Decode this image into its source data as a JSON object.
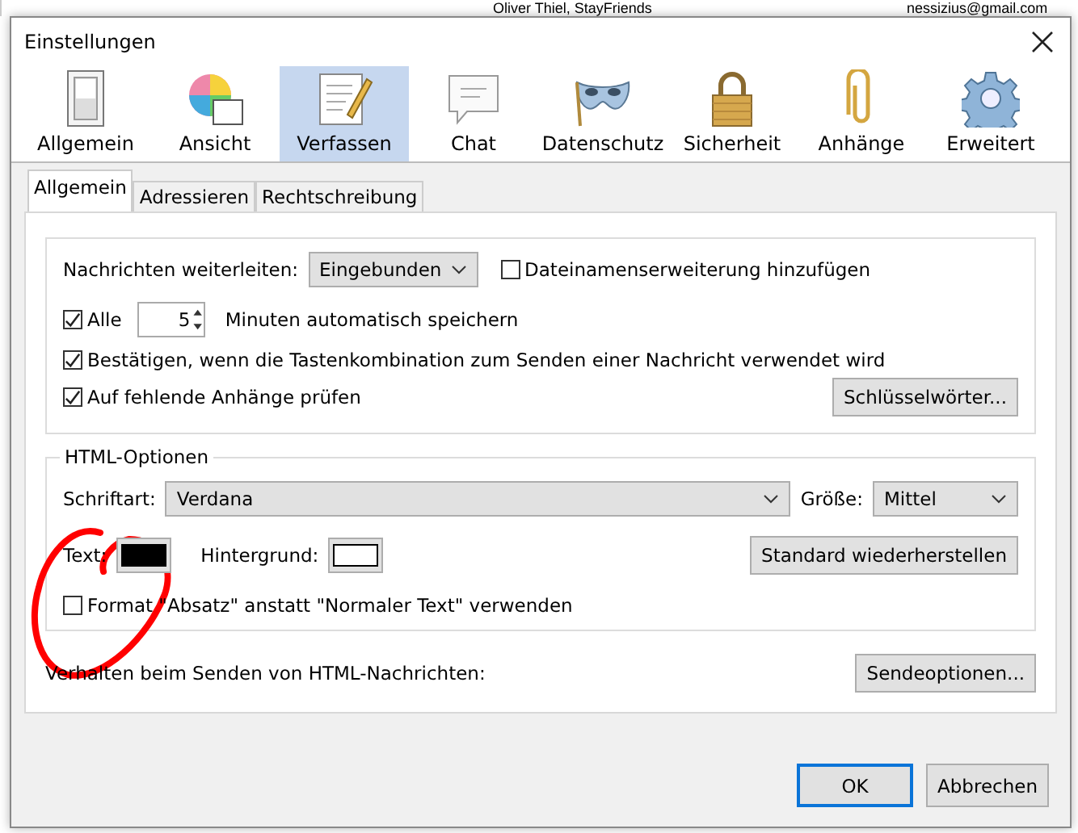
{
  "background": {
    "sender": "Oliver Thiel, StayFriends",
    "email": "nessizius@gmail.com"
  },
  "window": {
    "title": "Einstellungen"
  },
  "categories": [
    {
      "label": "Allgemein",
      "kind": "general",
      "selected": false
    },
    {
      "label": "Ansicht",
      "kind": "display",
      "selected": false
    },
    {
      "label": "Verfassen",
      "kind": "compose",
      "selected": true
    },
    {
      "label": "Chat",
      "kind": "chat",
      "selected": false
    },
    {
      "label": "Datenschutz",
      "kind": "privacy",
      "selected": false
    },
    {
      "label": "Sicherheit",
      "kind": "security",
      "selected": false
    },
    {
      "label": "Anhänge",
      "kind": "attachments",
      "selected": false
    },
    {
      "label": "Erweitert",
      "kind": "advanced",
      "selected": false
    }
  ],
  "tabs": [
    {
      "label": "Allgemein",
      "selected": true
    },
    {
      "label": "Adressieren",
      "selected": false
    },
    {
      "label": "Rechtschreibung",
      "selected": false
    }
  ],
  "forwarding": {
    "label": "Nachrichten weiterleiten:",
    "value": "Eingebunden",
    "extension": {
      "label": "Dateinamenserweiterung hinzufügen",
      "checked": false
    }
  },
  "autosave": {
    "label": "Alle",
    "checked": true,
    "value": "5",
    "suffix": "Minuten automatisch speichern"
  },
  "confirm": {
    "label": "Bestätigen, wenn die Tastenkombination zum Senden einer Nachricht verwendet wird",
    "checked": true
  },
  "attachments": {
    "label": "Auf fehlende Anhänge prüfen",
    "checked": true,
    "button": "Schlüsselwörter..."
  },
  "html_options": {
    "title": "HTML-Optionen",
    "font_label": "Schriftart:",
    "font": "Verdana",
    "size_label": "Größe:",
    "size": "Mittel",
    "text_label": "Text:",
    "background_label": "Hintergrund:",
    "reset_button": "Standard wiederherstellen",
    "paragraph": {
      "label": "Format \"Absatz\" anstatt \"Normaler Text\" verwenden",
      "checked": false
    }
  },
  "send": {
    "label": "Verhalten beim Senden von HTML-Nachrichten:",
    "button": "Sendeoptionen..."
  },
  "buttons": [
    {
      "label": "OK",
      "kind": "default"
    },
    {
      "label": "Abbrechen",
      "kind": "normal"
    }
  ]
}
